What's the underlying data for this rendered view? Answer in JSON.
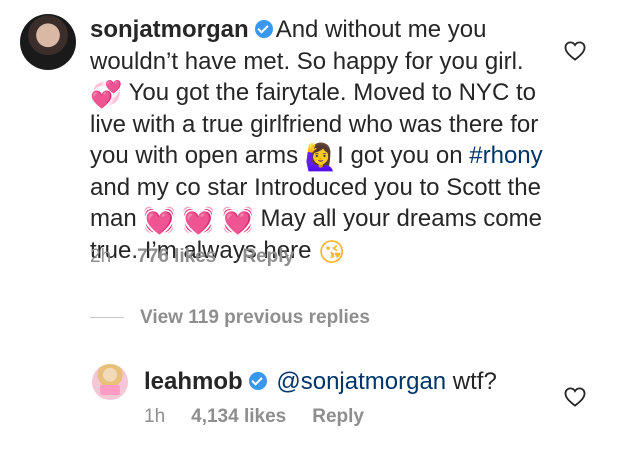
{
  "comment1": {
    "username": "sonjatmorgan",
    "text_1": "And without me you wouldn’t have met. So happy for you girl. ",
    "emoji_1": "💞",
    "text_2": " You got the fairytale. Moved to NYC to live with a true girlfriend who was there for you with open arms ",
    "emoji_2": "🙋‍♀️",
    "text_3": "I got you on ",
    "hashtag": "#rhony",
    "text_4": " and my co star Introduced you to Scott the man ",
    "emoji_3": "💓",
    "emoji_4": "💓",
    "emoji_5": "💓",
    "text_5": " May all your dreams come true. I’m always here ",
    "emoji_6": "😘",
    "time": "2h",
    "likes": "776 likes",
    "reply": "Reply"
  },
  "view_replies": "View 119 previous replies",
  "comment2": {
    "username": "leahmob",
    "mention": "@sonjatmorgan",
    "text": " wtf?",
    "time": "1h",
    "likes": "4,134 likes",
    "reply": "Reply"
  },
  "colors": {
    "verified": "#3897f0",
    "meta": "#8e8e8e",
    "link": "#003569"
  }
}
